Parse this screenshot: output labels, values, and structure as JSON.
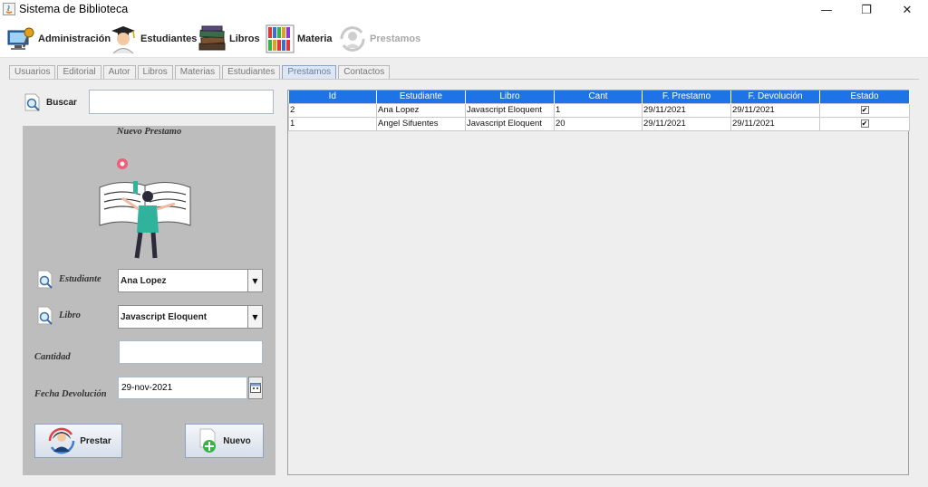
{
  "window": {
    "title": "Sistema de Biblioteca",
    "minimize": "—",
    "maximize": "❐",
    "close": "✕"
  },
  "menu": [
    {
      "label": "Administración",
      "icon": "admin-icon",
      "enabled": true
    },
    {
      "label": "Estudiantes",
      "icon": "student-icon",
      "enabled": true
    },
    {
      "label": "Libros",
      "icon": "books-stack-icon",
      "enabled": true
    },
    {
      "label": "Materia",
      "icon": "bookshelf-icon",
      "enabled": true
    },
    {
      "label": "Prestamos",
      "icon": "loan-user-icon",
      "enabled": false
    }
  ],
  "tabs": [
    {
      "label": "Usuarios",
      "active": false
    },
    {
      "label": "Editorial",
      "active": false
    },
    {
      "label": "Autor",
      "active": false
    },
    {
      "label": "Libros",
      "active": false
    },
    {
      "label": "Materias",
      "active": false
    },
    {
      "label": "Estudiantes",
      "active": false
    },
    {
      "label": "Prestamos",
      "active": true
    },
    {
      "label": "Contactos",
      "active": false
    }
  ],
  "search": {
    "button_label": "Buscar",
    "value": ""
  },
  "form": {
    "title": "Nuevo Prestamo",
    "student_label": "Estudiante",
    "student_value": "Ana Lopez",
    "book_label": "Libro",
    "book_value": "Javascript Eloquent",
    "quantity_label": "Cantidad",
    "quantity_value": "",
    "return_date_label": "Fecha Devolución",
    "return_date_value": "29-nov-2021",
    "lend_button": "Prestar",
    "new_button": "Nuevo"
  },
  "table": {
    "columns": [
      "Id",
      "Estudiante",
      "Libro",
      "Cant",
      "F. Prestamo",
      "F. Devolución",
      "Estado"
    ],
    "rows": [
      {
        "id": "2",
        "student": "Ana Lopez",
        "book": "Javascript Eloquent",
        "qty": "1",
        "loan_date": "29/11/2021",
        "return_date": "29/11/2021",
        "status_checked": true
      },
      {
        "id": "1",
        "student": "Angel Sifuentes",
        "book": "Javascript Eloquent",
        "qty": "20",
        "loan_date": "29/11/2021",
        "return_date": "29/11/2021",
        "status_checked": true
      }
    ]
  },
  "colors": {
    "table_header": "#1e74e6",
    "panel_bg": "#bdbdbd",
    "window_bg": "#eeeeee"
  }
}
